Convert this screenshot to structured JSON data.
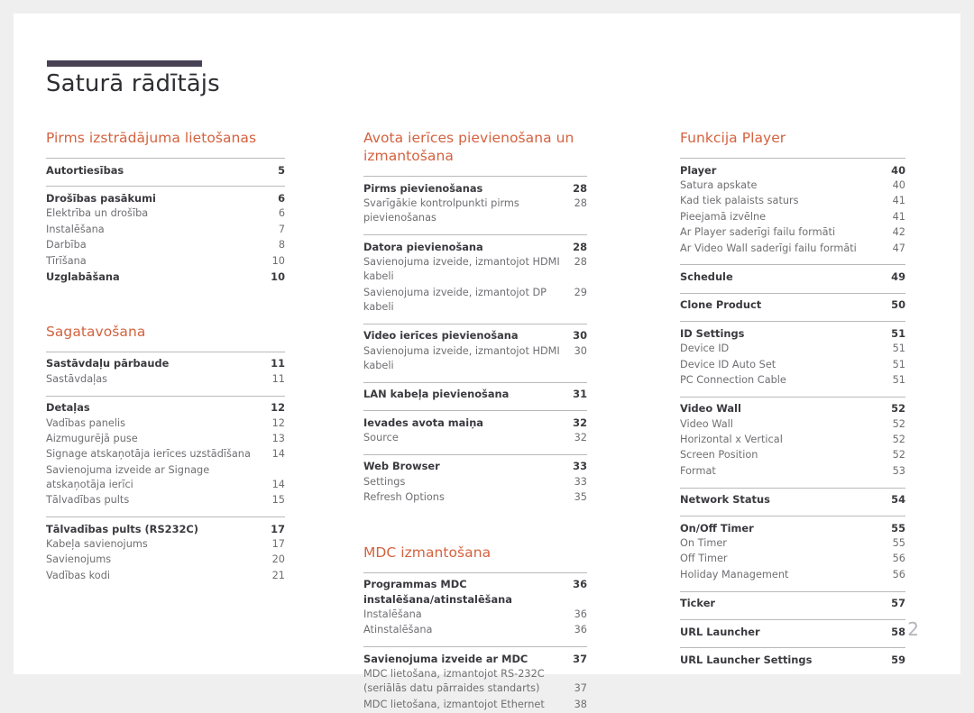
{
  "document": {
    "title": "Saturā rādītājs",
    "folio": "2",
    "accent_color": "#d4623f",
    "rule_color": "#474254"
  },
  "columns": [
    {
      "sections": [
        {
          "heading": "Pirms izstrādājuma lietošanas",
          "groups": [
            {
              "entries": [
                {
                  "label": "Autortiesības",
                  "page": "5",
                  "level": "main"
                }
              ]
            },
            {
              "entries": [
                {
                  "label": "Drošības pasākumi",
                  "page": "6",
                  "level": "main"
                },
                {
                  "label": "Elektrība un drošība",
                  "page": "6",
                  "level": "sub"
                },
                {
                  "label": "Instalēšana",
                  "page": "7",
                  "level": "sub"
                },
                {
                  "label": "Darbība",
                  "page": "8",
                  "level": "sub"
                },
                {
                  "label": "Tīrīšana",
                  "page": "10",
                  "level": "sub"
                },
                {
                  "label": "Uzglabāšana",
                  "page": "10",
                  "level": "main"
                }
              ]
            }
          ]
        },
        {
          "heading": "Sagatavošana",
          "groups": [
            {
              "entries": [
                {
                  "label": "Sastāvdaļu pārbaude",
                  "page": "11",
                  "level": "main"
                },
                {
                  "label": "Sastāvdaļas",
                  "page": "11",
                  "level": "sub"
                }
              ]
            },
            {
              "entries": [
                {
                  "label": "Detaļas",
                  "page": "12",
                  "level": "main"
                },
                {
                  "label": "Vadības panelis",
                  "page": "12",
                  "level": "sub"
                },
                {
                  "label": "Aizmugurējā puse",
                  "page": "13",
                  "level": "sub"
                },
                {
                  "label": "Signage atskaņotāja ierīces uzstādīšana",
                  "page": "14",
                  "level": "sub"
                },
                {
                  "label": "Savienojuma izveide ar Signage atskaņotāja ierīci",
                  "page": "14",
                  "level": "sub",
                  "wrap": true
                },
                {
                  "label": "Tālvadības pults",
                  "page": "15",
                  "level": "sub"
                }
              ]
            },
            {
              "entries": [
                {
                  "label": "Tālvadības pults (RS232C)",
                  "page": "17",
                  "level": "main"
                },
                {
                  "label": "Kabeļa savienojums",
                  "page": "17",
                  "level": "sub"
                },
                {
                  "label": "Savienojums",
                  "page": "20",
                  "level": "sub"
                },
                {
                  "label": "Vadības kodi",
                  "page": "21",
                  "level": "sub"
                }
              ]
            }
          ]
        }
      ]
    },
    {
      "sections": [
        {
          "heading": "Avota ierīces pievienošana un izmantošana",
          "groups": [
            {
              "entries": [
                {
                  "label": "Pirms pievienošanas",
                  "page": "28",
                  "level": "main"
                },
                {
                  "label": "Svarīgākie kontrolpunkti pirms pievienošanas",
                  "page": "28",
                  "level": "sub",
                  "tight": true
                }
              ]
            },
            {
              "entries": [
                {
                  "label": "Datora pievienošana",
                  "page": "28",
                  "level": "main"
                },
                {
                  "label": "Savienojuma izveide, izmantojot HDMI kabeli",
                  "page": "28",
                  "level": "sub",
                  "tight": true
                },
                {
                  "label": "Savienojuma izveide, izmantojot DP kabeli",
                  "page": "29",
                  "level": "sub"
                }
              ]
            },
            {
              "entries": [
                {
                  "label": "Video ierīces pievienošana",
                  "page": "30",
                  "level": "main"
                },
                {
                  "label": "Savienojuma izveide, izmantojot HDMI kabeli",
                  "page": "30",
                  "level": "sub",
                  "tight": true
                }
              ]
            },
            {
              "entries": [
                {
                  "label": "LAN kabeļa pievienošana",
                  "page": "31",
                  "level": "main"
                }
              ]
            },
            {
              "entries": [
                {
                  "label": "Ievades avota maiņa",
                  "page": "32",
                  "level": "main"
                },
                {
                  "label": "Source",
                  "page": "32",
                  "level": "sub"
                }
              ]
            },
            {
              "entries": [
                {
                  "label": "Web Browser",
                  "page": "33",
                  "level": "main"
                },
                {
                  "label": "Settings",
                  "page": "33",
                  "level": "sub"
                },
                {
                  "label": "Refresh Options",
                  "page": "35",
                  "level": "sub"
                }
              ]
            }
          ]
        },
        {
          "heading": "MDC izmantošana",
          "groups": [
            {
              "entries": [
                {
                  "label": "Programmas MDC instalēšana/atinstalēšana",
                  "page": "36",
                  "level": "main",
                  "tight": true
                },
                {
                  "label": "Instalēšana",
                  "page": "36",
                  "level": "sub"
                },
                {
                  "label": "Atinstalēšana",
                  "page": "36",
                  "level": "sub"
                }
              ]
            },
            {
              "entries": [
                {
                  "label": "Savienojuma izveide ar MDC",
                  "page": "37",
                  "level": "main"
                },
                {
                  "label": "MDC lietošana, izmantojot RS-232C (seriālās datu pārraides standarts)",
                  "page": "37",
                  "level": "sub",
                  "wrap": true
                },
                {
                  "label": "MDC lietošana, izmantojot Ethernet",
                  "page": "38",
                  "level": "sub"
                }
              ]
            }
          ]
        }
      ]
    },
    {
      "sections": [
        {
          "heading": "Funkcija Player",
          "groups": [
            {
              "entries": [
                {
                  "label": "Player",
                  "page": "40",
                  "level": "main"
                },
                {
                  "label": "Satura apskate",
                  "page": "40",
                  "level": "sub"
                },
                {
                  "label": "Kad tiek palaists saturs",
                  "page": "41",
                  "level": "sub"
                },
                {
                  "label": "Pieejamā izvēlne",
                  "page": "41",
                  "level": "sub"
                },
                {
                  "label": "Ar Player saderīgi failu formāti",
                  "page": "42",
                  "level": "sub"
                },
                {
                  "label": "Ar Video Wall saderīgi failu formāti",
                  "page": "47",
                  "level": "sub"
                }
              ]
            },
            {
              "entries": [
                {
                  "label": "Schedule",
                  "page": "49",
                  "level": "main"
                }
              ]
            },
            {
              "entries": [
                {
                  "label": "Clone Product",
                  "page": "50",
                  "level": "main"
                }
              ]
            },
            {
              "entries": [
                {
                  "label": "ID Settings",
                  "page": "51",
                  "level": "main"
                },
                {
                  "label": "Device ID",
                  "page": "51",
                  "level": "sub"
                },
                {
                  "label": "Device ID Auto Set",
                  "page": "51",
                  "level": "sub"
                },
                {
                  "label": "PC Connection Cable",
                  "page": "51",
                  "level": "sub"
                }
              ]
            },
            {
              "entries": [
                {
                  "label": "Video Wall",
                  "page": "52",
                  "level": "main"
                },
                {
                  "label": "Video Wall",
                  "page": "52",
                  "level": "sub"
                },
                {
                  "label": "Horizontal x Vertical",
                  "page": "52",
                  "level": "sub"
                },
                {
                  "label": "Screen Position",
                  "page": "52",
                  "level": "sub"
                },
                {
                  "label": "Format",
                  "page": "53",
                  "level": "sub"
                }
              ]
            },
            {
              "entries": [
                {
                  "label": "Network Status",
                  "page": "54",
                  "level": "main"
                }
              ]
            },
            {
              "entries": [
                {
                  "label": "On/Off Timer",
                  "page": "55",
                  "level": "main"
                },
                {
                  "label": "On Timer",
                  "page": "55",
                  "level": "sub"
                },
                {
                  "label": "Off Timer",
                  "page": "56",
                  "level": "sub"
                },
                {
                  "label": "Holiday Management",
                  "page": "56",
                  "level": "sub"
                }
              ]
            },
            {
              "entries": [
                {
                  "label": "Ticker",
                  "page": "57",
                  "level": "main"
                }
              ]
            },
            {
              "entries": [
                {
                  "label": "URL Launcher",
                  "page": "58",
                  "level": "main"
                }
              ]
            },
            {
              "entries": [
                {
                  "label": "URL Launcher Settings",
                  "page": "59",
                  "level": "main"
                }
              ]
            }
          ]
        }
      ]
    }
  ]
}
